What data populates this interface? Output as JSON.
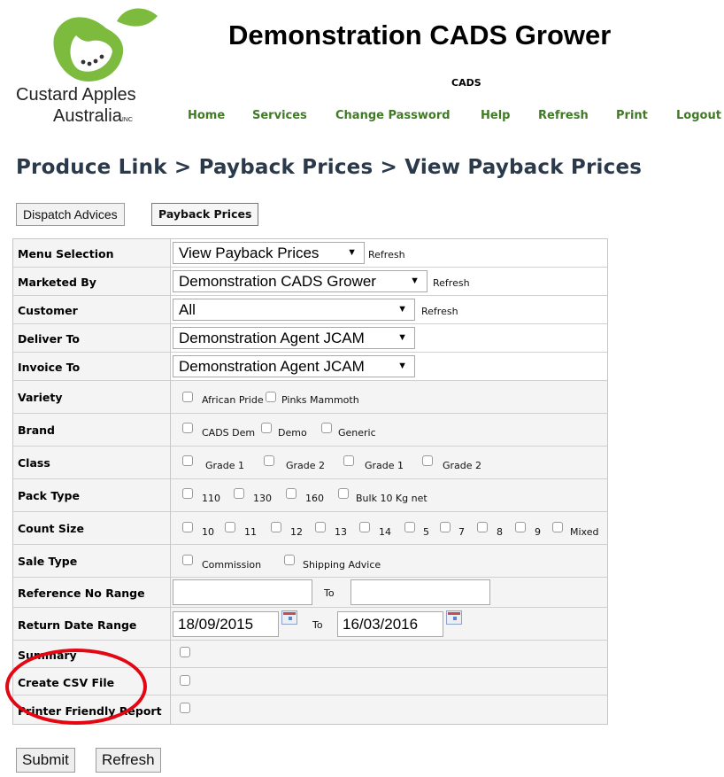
{
  "header": {
    "logo_line1": "Custard Apples",
    "logo_line2": "Australia",
    "logo_suffix": "INC",
    "title": "Demonstration CADS Grower",
    "subtitle": "CADS"
  },
  "nav": [
    "Home",
    "Services",
    "Change Password",
    "Help",
    "Refresh",
    "Print",
    "Logout"
  ],
  "breadcrumb": "Produce Link > Payback Prices > View Payback Prices",
  "tabs": [
    "Dispatch Advices",
    "Payback Prices"
  ],
  "form": {
    "menu_selection": {
      "label": "Menu Selection",
      "value": "View Payback Prices",
      "link": "Refresh"
    },
    "marketed_by": {
      "label": "Marketed By",
      "value": "Demonstration CADS Grower",
      "link": "Refresh"
    },
    "customer": {
      "label": "Customer",
      "value": "All",
      "link": "Refresh"
    },
    "deliver_to": {
      "label": "Deliver To",
      "value": "Demonstration Agent JCAM"
    },
    "invoice_to": {
      "label": "Invoice To",
      "value": "Demonstration Agent JCAM"
    },
    "variety": {
      "label": "Variety",
      "options": [
        "African Pride",
        "Pinks Mammoth"
      ]
    },
    "brand": {
      "label": "Brand",
      "options": [
        "CADS Dem",
        "Demo",
        "Generic"
      ]
    },
    "class": {
      "label": "Class",
      "options": [
        "Grade 1",
        "Grade 2",
        "Grade 1",
        "Grade 2"
      ]
    },
    "pack_type": {
      "label": "Pack Type",
      "options": [
        "110",
        "130",
        "160",
        "Bulk 10 Kg net"
      ]
    },
    "count_size": {
      "label": "Count Size",
      "options": [
        "10",
        "11",
        "12",
        "13",
        "14",
        "5",
        "7",
        "8",
        "9",
        "Mixed"
      ]
    },
    "sale_type": {
      "label": "Sale Type",
      "options": [
        "Commission",
        "Shipping Advice"
      ]
    },
    "reference_no_range": {
      "label": "Reference No Range",
      "from": "",
      "to_label": "To",
      "to": ""
    },
    "return_date_range": {
      "label": "Return Date Range",
      "from": "18/09/2015",
      "to_label": "To",
      "to": "16/03/2016"
    },
    "summary": {
      "label": "Summary"
    },
    "create_csv": {
      "label": "Create CSV File"
    },
    "printer_friendly": {
      "label": "Printer Friendly Report"
    }
  },
  "buttons": {
    "submit": "Submit",
    "refresh": "Refresh"
  },
  "colors": {
    "nav": "#3f7a25",
    "breadcrumb": "#2b3a4a",
    "annotation": "#e30613"
  }
}
